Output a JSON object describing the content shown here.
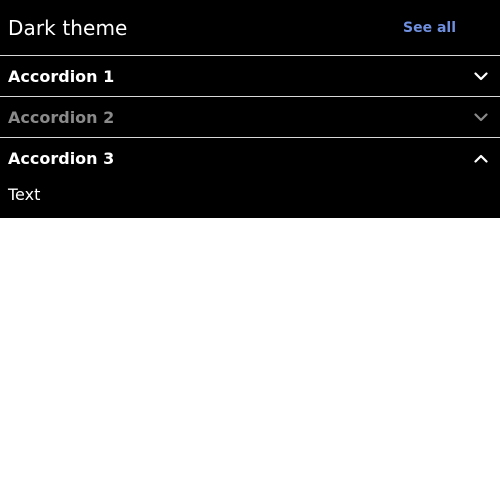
{
  "header": {
    "title": "Dark theme",
    "see_all_label": "See all"
  },
  "accordions": [
    {
      "label": "Accordion 1",
      "state": "collapsed",
      "disabled": false
    },
    {
      "label": "Accordion 2",
      "state": "collapsed",
      "disabled": true
    },
    {
      "label": "Accordion 3",
      "state": "expanded",
      "disabled": false,
      "content": "Text"
    }
  ],
  "colors": {
    "background": "#000000",
    "text": "#ffffff",
    "link": "#6f8fdf",
    "disabled_text": "#8a8a8a",
    "divider": "#d9d9d9"
  },
  "icons": {
    "collapsed": "chevron-down-icon",
    "expanded": "chevron-up-icon"
  }
}
